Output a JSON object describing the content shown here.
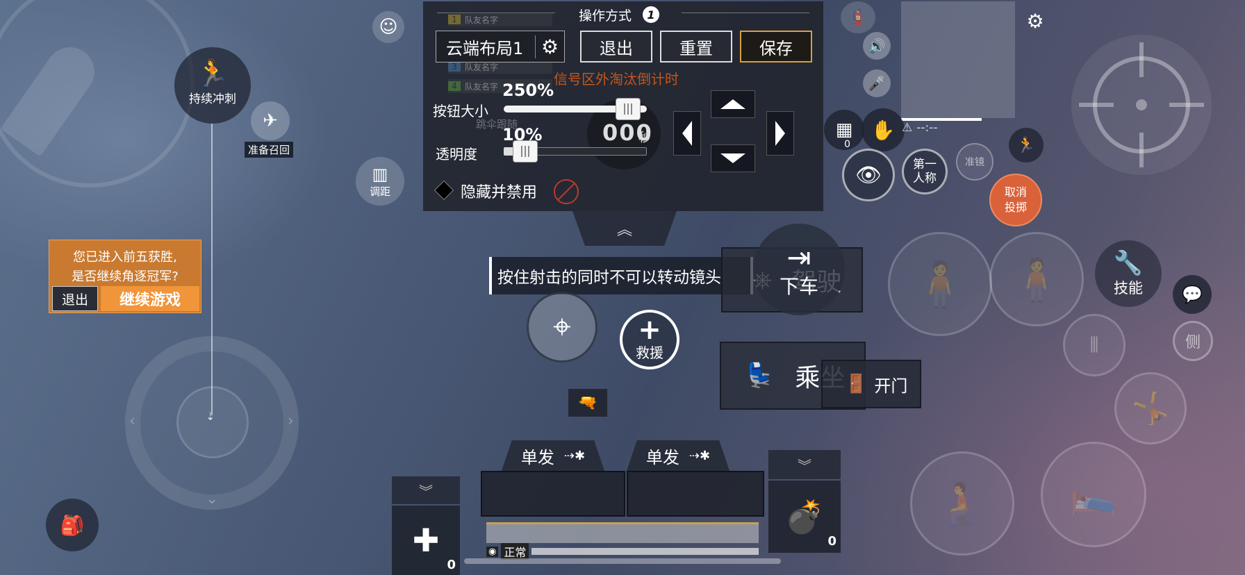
{
  "panel": {
    "title": "操作方式",
    "title_badge": "1",
    "layout_name": "云端布局1",
    "exit_label": "退出",
    "reset_label": "重置",
    "save_label": "保存",
    "countdown_label": "信号区外淘汰倒计时",
    "countdown_value": "000",
    "countdown_unit": "秒",
    "button_size_label": "按钮大小",
    "button_size_value": "250%",
    "button_size_fraction": 0.87,
    "opacity_label": "透明度",
    "opacity_value": "10%",
    "opacity_fraction": 0.15,
    "hide_disable_label": "隐藏并禁用"
  },
  "teammates": [
    {
      "num": "1",
      "name": "队友名字",
      "color": "#e0c040"
    },
    {
      "num": "3",
      "name": "队友名字",
      "color": "#4a8fd0"
    },
    {
      "num": "4",
      "name": "队友名字",
      "color": "#6ab04c"
    }
  ],
  "parachute_follow": "跳伞跟随",
  "left": {
    "sprint_label": "持续冲刺",
    "drone_label": "准备召回",
    "range_label": "调距"
  },
  "top5_prompt": {
    "line1": "您已进入前五获胜,",
    "line2": "是否继续角逐冠军?",
    "exit_label": "退出",
    "continue_label": "继续游戏"
  },
  "tooltip": "按住射击的同时不可以转动镜头",
  "center": {
    "rescue_label": "救援",
    "drive_label": "驾驶",
    "exit_vehicle_label": "下车",
    "ride_label": "乘坐",
    "open_door_label": "开门"
  },
  "fire_modes": [
    {
      "label": "单发"
    },
    {
      "label": "单发"
    }
  ],
  "medkit_count": "0",
  "grenade_count": "0",
  "status_label": "正常",
  "right": {
    "ammo_box_count": "0",
    "first_person_label": "第一人称",
    "scope_label": "准镜",
    "cancel_throw_label": "取消投掷",
    "skill_label": "技能",
    "lean_label": "侧",
    "signal_label": "--:--"
  },
  "colors": {
    "accent_orange": "#e8893a",
    "save_border": "#e0a040",
    "cancel_red": "#d9623a",
    "countdown_text": "#c4561c"
  }
}
